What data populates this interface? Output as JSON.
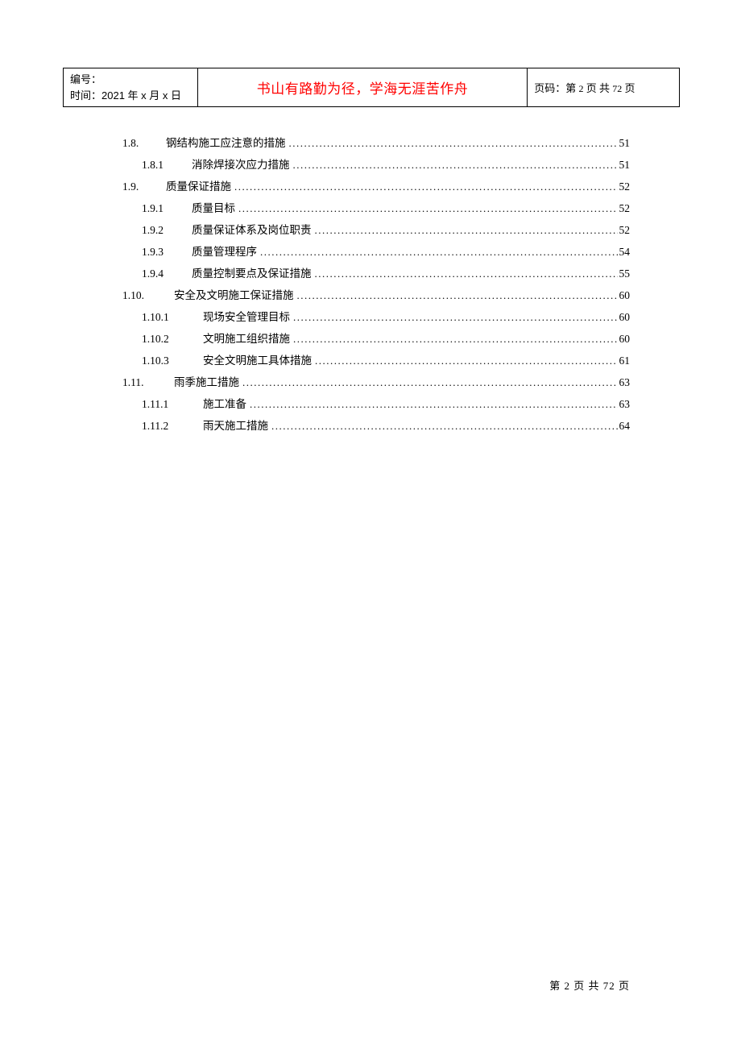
{
  "header": {
    "left_line1": "编号：",
    "left_line2": "时间：2021 年 x 月 x 日",
    "center": "书山有路勤为径，学海无涯苦作舟",
    "right_prefix": "页码：第",
    "right_page": "2",
    "right_mid": "页  共",
    "right_total": "72",
    "right_suffix": "页"
  },
  "toc": [
    {
      "level": "1",
      "num": "1.8.",
      "title": "钢结构施工应注意的措施",
      "page": "51"
    },
    {
      "level": "2",
      "num": "1.8.1",
      "title": "消除焊接次应力措施",
      "page": "51"
    },
    {
      "level": "1",
      "num": "1.9.",
      "title": "质量保证措施",
      "page": "52"
    },
    {
      "level": "2",
      "num": "1.9.1",
      "title": "质量目标",
      "page": "52"
    },
    {
      "level": "2",
      "num": "1.9.2",
      "title": "质量保证体系及岗位职责",
      "page": "52"
    },
    {
      "level": "2",
      "num": "1.9.3",
      "title": "质量管理程序",
      "page": "54"
    },
    {
      "level": "2",
      "num": "1.9.4",
      "title": "质量控制要点及保证措施",
      "page": "55"
    },
    {
      "level": "1b",
      "num": "1.10.",
      "title": "安全及文明施工保证措施",
      "page": "60"
    },
    {
      "level": "2b",
      "num": "1.10.1",
      "title": "现场安全管理目标",
      "page": "60"
    },
    {
      "level": "2b",
      "num": "1.10.2",
      "title": "文明施工组织措施",
      "page": "60"
    },
    {
      "level": "2b",
      "num": "1.10.3",
      "title": "安全文明施工具体措施",
      "page": "61"
    },
    {
      "level": "1b",
      "num": "1.11.",
      "title": "雨季施工措施",
      "page": "63"
    },
    {
      "level": "2b",
      "num": "1.11.1",
      "title": "施工准备",
      "page": "63"
    },
    {
      "level": "2b",
      "num": "1.11.2",
      "title": "雨天施工措施",
      "page": "64"
    }
  ],
  "dots": "..................................................................................................................................................................",
  "footer": {
    "text_prefix": "第",
    "page": "2",
    "text_mid": "页 共",
    "total": "72",
    "text_suffix": "页"
  }
}
